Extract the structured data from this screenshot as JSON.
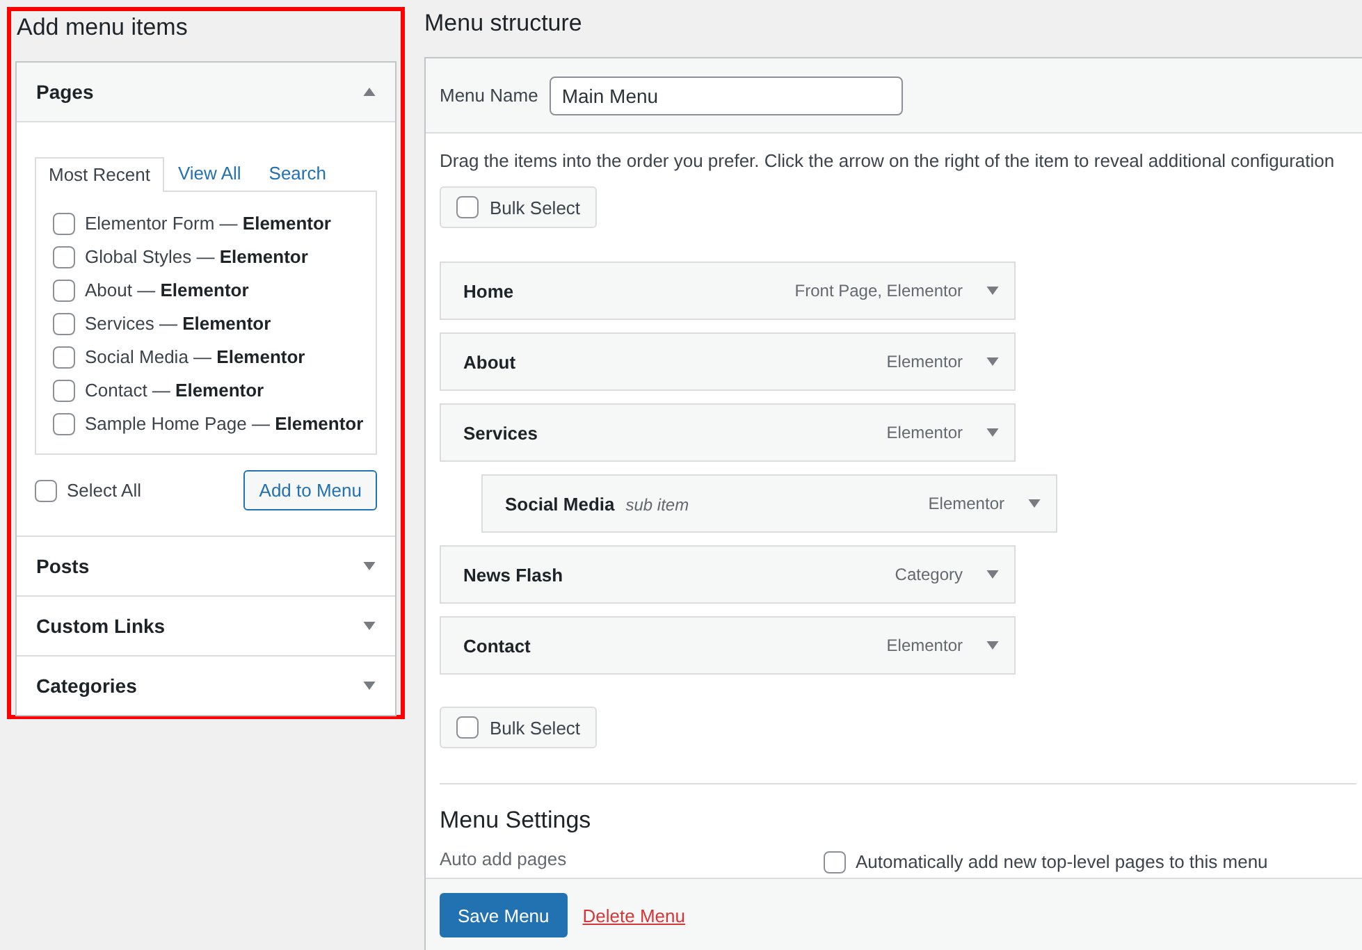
{
  "add_items": {
    "title": "Add menu items",
    "panels": [
      {
        "title": "Pages",
        "expanded": true,
        "tabs": [
          {
            "label": "Most Recent",
            "selected": true
          },
          {
            "label": "View All",
            "selected": false
          },
          {
            "label": "Search",
            "selected": false
          }
        ],
        "items": [
          {
            "label": "Elementor Form — **Elementor**",
            "checked": false
          },
          {
            "label": "Global Styles — **Elementor**",
            "checked": false
          },
          {
            "label": "About — **Elementor**",
            "checked": false
          },
          {
            "label": "Services — **Elementor**",
            "checked": false
          },
          {
            "label": "Social Media — **Elementor**",
            "checked": false
          },
          {
            "label": "Contact — **Elementor**",
            "checked": false
          },
          {
            "label": "Sample Home Page — **Elementor**",
            "checked": false
          }
        ],
        "select_all": {
          "label": "Select All",
          "checked": false
        },
        "add_button": "Add to Menu"
      },
      {
        "title": "Posts",
        "expanded": false
      },
      {
        "title": "Custom Links",
        "expanded": false
      },
      {
        "title": "Categories",
        "expanded": false
      }
    ]
  },
  "menu_structure": {
    "title": "Menu structure",
    "menu_name": {
      "label": "Menu Name",
      "value": "Main Menu"
    },
    "instructions": "Drag the items into the order you prefer. Click the arrow on the right of the item to reveal additional configuration",
    "bulk_select_top": {
      "label": "Bulk Select",
      "checked": false
    },
    "items": [
      {
        "title": "Home",
        "type": "Front Page, Elementor"
      },
      {
        "title": "About",
        "type": "Elementor"
      },
      {
        "title": "Services",
        "type": "Elementor",
        "children": [
          {
            "title": "Social Media",
            "sub_label": "sub item",
            "type": "Elementor"
          }
        ]
      },
      {
        "title": "News Flash",
        "type": "Category"
      },
      {
        "title": "Contact",
        "type": "Elementor"
      }
    ],
    "bulk_select_bottom": {
      "label": "Bulk Select",
      "checked": false
    },
    "settings": {
      "title": "Menu Settings",
      "auto_add_label": "Auto add pages",
      "auto_add_option": {
        "label": "Automatically add new top-level pages to this menu",
        "checked": false
      }
    },
    "footer": {
      "save": "Save Menu",
      "delete": "Delete Menu"
    }
  }
}
